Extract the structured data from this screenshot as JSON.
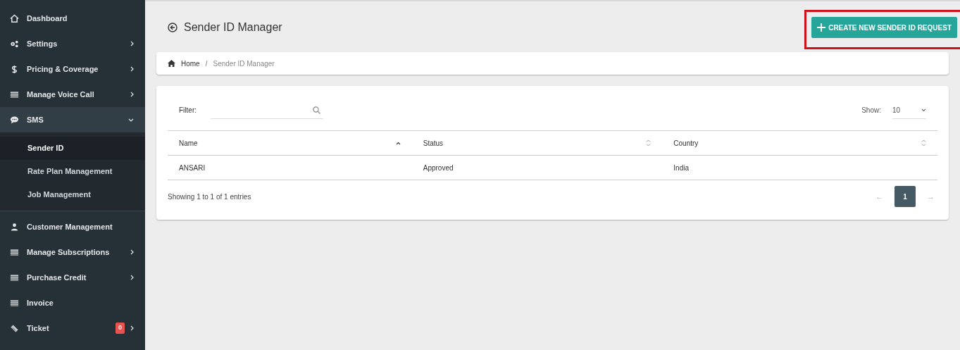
{
  "sidebar": {
    "items": [
      {
        "label": "Dashboard",
        "kind": "home",
        "submenu": false,
        "expanded": false
      },
      {
        "label": "Settings",
        "kind": "gears",
        "submenu": true,
        "expanded": false
      },
      {
        "label": "Pricing & Coverage",
        "kind": "dollar",
        "submenu": true,
        "expanded": false
      },
      {
        "label": "Manage Voice Call",
        "kind": "list",
        "submenu": true,
        "expanded": false
      },
      {
        "label": "SMS",
        "kind": "chat",
        "submenu": true,
        "expanded": true,
        "children": [
          {
            "label": "Sender ID",
            "selected": true
          },
          {
            "label": "Rate Plan Management",
            "selected": false
          },
          {
            "label": "Job Management",
            "selected": false
          }
        ]
      },
      {
        "label": "Customer Management",
        "kind": "user",
        "submenu": false,
        "expanded": false
      },
      {
        "label": "Manage Subscriptions",
        "kind": "list",
        "submenu": true,
        "expanded": false
      },
      {
        "label": "Purchase Credit",
        "kind": "list",
        "submenu": true,
        "expanded": false
      },
      {
        "label": "Invoice",
        "kind": "list",
        "submenu": false,
        "expanded": false
      },
      {
        "label": "Ticket",
        "kind": "ticket",
        "submenu": true,
        "expanded": false,
        "badge": "0"
      }
    ]
  },
  "header": {
    "title": "Sender ID Manager",
    "action_button": "CREATE NEW SENDER ID REQUEST",
    "highlighted": true
  },
  "breadcrumb": [
    "Home",
    "Sender ID Manager"
  ],
  "breadcrumb_separator": "/",
  "table": {
    "filter_label": "Filter:",
    "show_label": "Show:",
    "page_size": "10",
    "columns": [
      {
        "label": "Name",
        "sorted": true
      },
      {
        "label": "Status",
        "sorted": false
      },
      {
        "label": "Country",
        "sorted": false
      }
    ],
    "rows": [
      [
        "ANSARI",
        "Approved",
        "India"
      ]
    ],
    "info": "Showing 1 to 1 of 1 entries",
    "pages": [
      {
        "label": "1",
        "selected": true
      }
    ],
    "prev": "←",
    "next": "→"
  }
}
